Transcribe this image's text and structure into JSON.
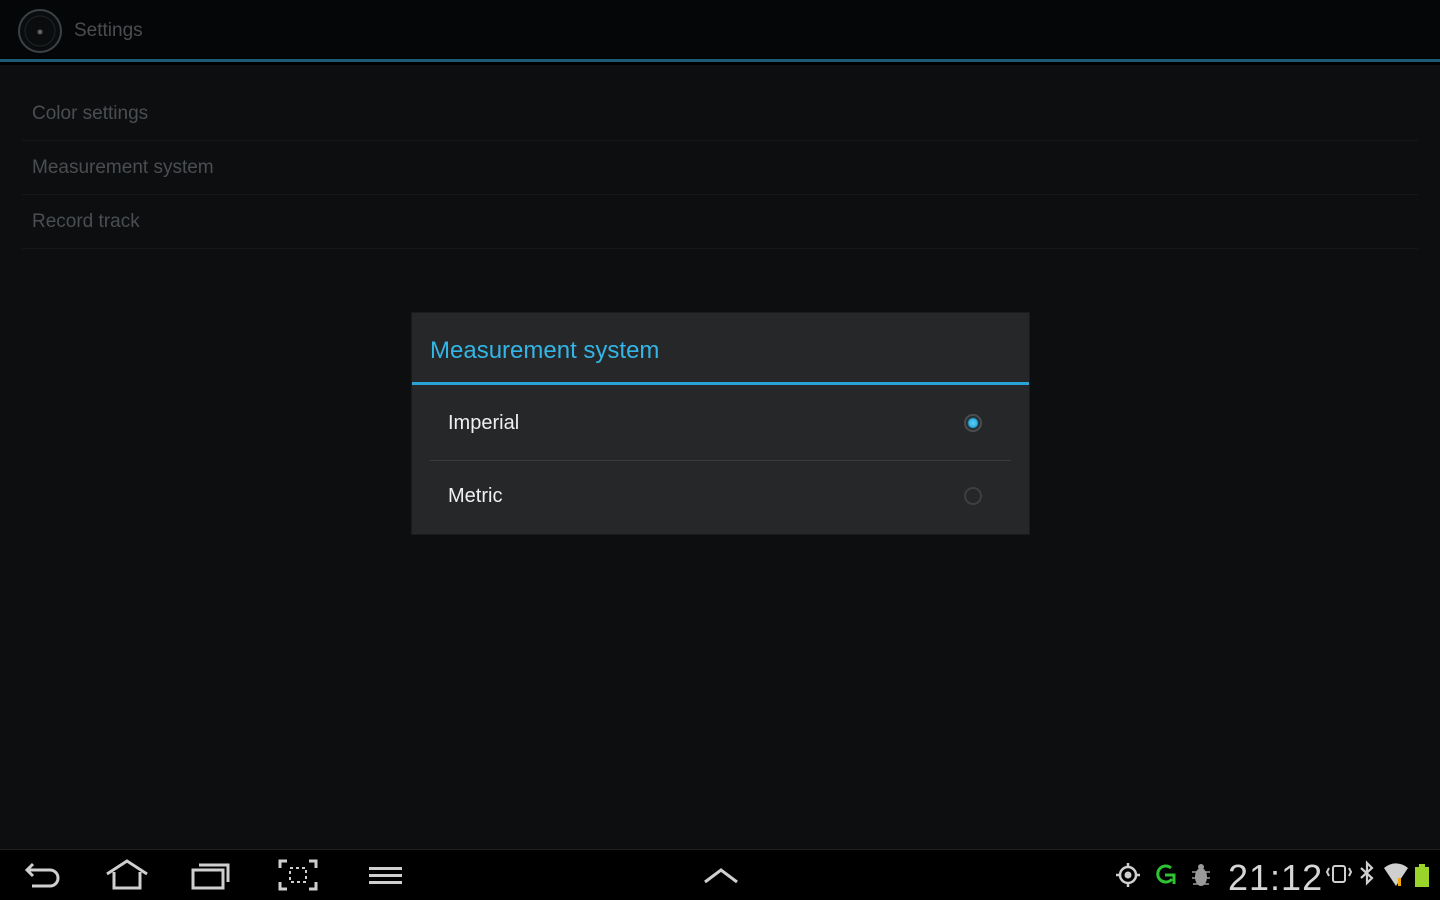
{
  "action_bar": {
    "title": "Settings",
    "app_icon": "speedometer-icon"
  },
  "preferences": {
    "items": [
      {
        "label": "Color settings"
      },
      {
        "label": "Measurement system"
      },
      {
        "label": "Record track"
      }
    ]
  },
  "dialog": {
    "title": "Measurement system",
    "options": [
      {
        "label": "Imperial",
        "selected": true
      },
      {
        "label": "Metric",
        "selected": false
      }
    ]
  },
  "system_bar": {
    "nav_icons": [
      "back-icon",
      "home-icon",
      "recent-apps-icon",
      "screenshot-icon",
      "menu-icon"
    ],
    "center_icon": "chevron-up-icon",
    "status_icons": [
      "gps-icon",
      "sync-icon",
      "debug-icon",
      "vibrate-icon",
      "bluetooth-icon",
      "wifi-icon",
      "battery-icon"
    ],
    "clock": "21:12"
  },
  "colors": {
    "accent": "#33b5e5",
    "dialog_bg": "#262729",
    "background": "#0c0e10"
  }
}
